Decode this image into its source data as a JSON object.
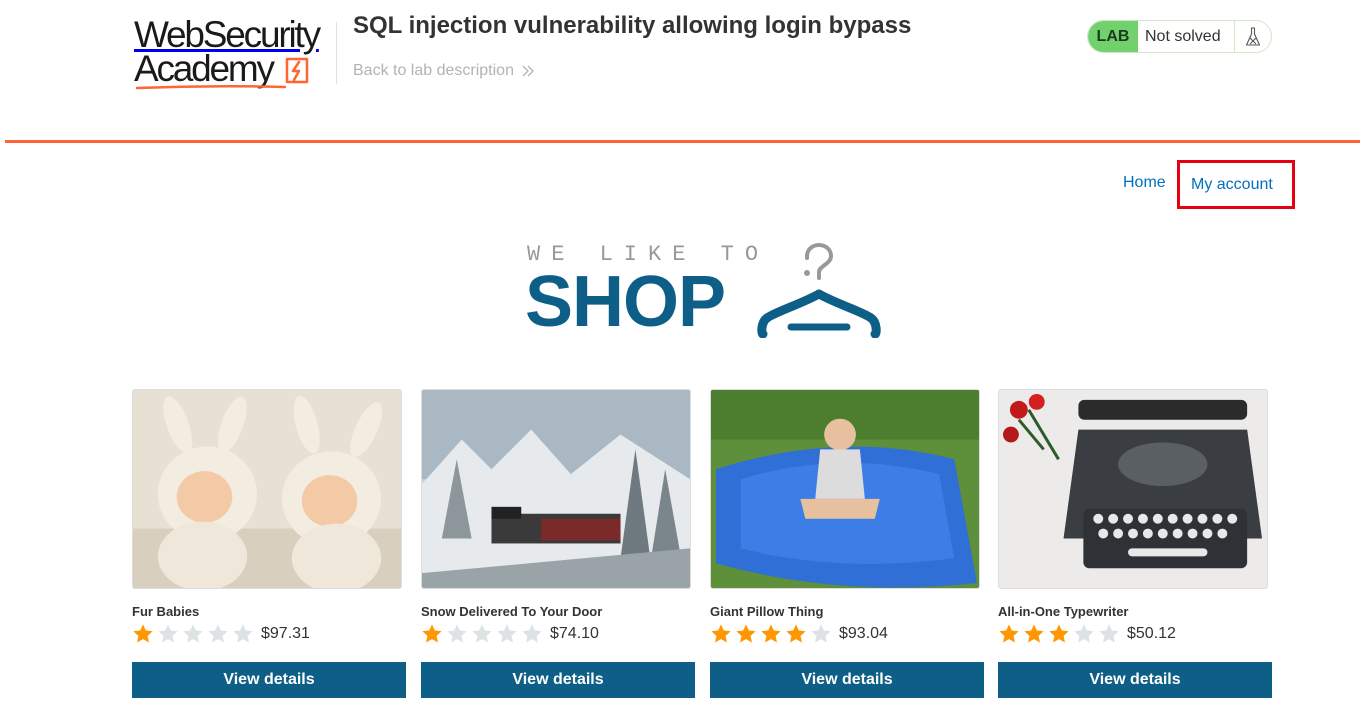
{
  "academy": {
    "logo_line1": "WebSecurity",
    "logo_line2": "Academy",
    "lab_title": "SQL injection vulnerability allowing login bypass",
    "back_link": "Back to lab description",
    "lab_badge": "LAB",
    "lab_status": "Not solved"
  },
  "nav": {
    "home": "Home",
    "my_account": "My account"
  },
  "banner": {
    "tagline": "WE LIKE TO",
    "headline": "SHOP"
  },
  "products": [
    {
      "name": "Fur Babies",
      "rating": 1,
      "max_rating": 5,
      "price": "$97.31",
      "button": "View details"
    },
    {
      "name": "Snow Delivered To Your Door",
      "rating": 1,
      "max_rating": 5,
      "price": "$74.10",
      "button": "View details"
    },
    {
      "name": "Giant Pillow Thing",
      "rating": 4,
      "max_rating": 5,
      "price": "$93.04",
      "button": "View details"
    },
    {
      "name": "All-in-One Typewriter",
      "rating": 3,
      "max_rating": 5,
      "price": "$50.12",
      "button": "View details"
    }
  ],
  "colors": {
    "accent_orange": "#ff6633",
    "brand_blue": "#0e5f87",
    "link_blue": "#0071bc",
    "lab_green": "#70d16d",
    "star_on": "#ff9800",
    "highlight_red": "#e60012"
  }
}
